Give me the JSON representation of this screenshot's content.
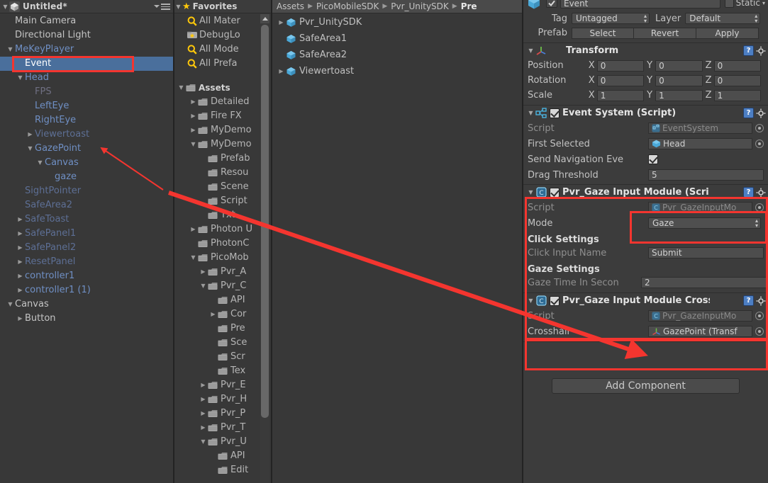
{
  "hierarchy": {
    "title": "Untitled*",
    "menu_icon": "hamburger-menu-icon",
    "items": [
      {
        "label": "Main Camera",
        "indent": 1,
        "tw": "",
        "style": "plain"
      },
      {
        "label": "Directional Light",
        "indent": 1,
        "tw": "",
        "style": "plain"
      },
      {
        "label": "MeKeyPlayer",
        "indent": 1,
        "tw": "down",
        "style": "go"
      },
      {
        "label": "Event",
        "indent": 2,
        "tw": "",
        "style": "go",
        "selected": true
      },
      {
        "label": "Head",
        "indent": 2,
        "tw": "down",
        "style": "go"
      },
      {
        "label": "FPS",
        "indent": 3,
        "tw": "",
        "style": "dim"
      },
      {
        "label": "LeftEye",
        "indent": 3,
        "tw": "",
        "style": "go"
      },
      {
        "label": "RightEye",
        "indent": 3,
        "tw": "",
        "style": "go"
      },
      {
        "label": "Viewertoast",
        "indent": 3,
        "tw": "right",
        "style": "dim-blue"
      },
      {
        "label": "GazePoint",
        "indent": 3,
        "tw": "down",
        "style": "go"
      },
      {
        "label": "Canvas",
        "indent": 4,
        "tw": "down",
        "style": "go"
      },
      {
        "label": "gaze",
        "indent": 5,
        "tw": "",
        "style": "go"
      },
      {
        "label": "SightPointer",
        "indent": 2,
        "tw": "",
        "style": "dim-blue"
      },
      {
        "label": "SafeArea2",
        "indent": 2,
        "tw": "",
        "style": "dim-blue"
      },
      {
        "label": "SafeToast",
        "indent": 2,
        "tw": "right",
        "style": "dim-blue"
      },
      {
        "label": "SafePanel1",
        "indent": 2,
        "tw": "right",
        "style": "dim-blue"
      },
      {
        "label": "SafePanel2",
        "indent": 2,
        "tw": "right",
        "style": "dim-blue"
      },
      {
        "label": "ResetPanel",
        "indent": 2,
        "tw": "right",
        "style": "dim-blue"
      },
      {
        "label": "controller1",
        "indent": 2,
        "tw": "right",
        "style": "go"
      },
      {
        "label": "controller1 (1)",
        "indent": 2,
        "tw": "right",
        "style": "go"
      },
      {
        "label": "Canvas",
        "indent": 1,
        "tw": "down",
        "style": "plain"
      },
      {
        "label": "Button",
        "indent": 2,
        "tw": "right",
        "style": "plain"
      }
    ]
  },
  "project_tree": {
    "favorites_label": "Favorites",
    "favorites": [
      {
        "label": "All Mater",
        "icon": "search-icon",
        "indent": 1
      },
      {
        "label": "DebugLo",
        "icon": "folder-favorite-icon",
        "indent": 1
      },
      {
        "label": "All Mode",
        "icon": "search-icon",
        "indent": 1
      },
      {
        "label": "All Prefa",
        "icon": "search-icon",
        "indent": 1
      }
    ],
    "assets_label": "Assets",
    "assets": [
      {
        "label": "Detailed",
        "indent": 1,
        "tw": "right"
      },
      {
        "label": "Fire FX",
        "indent": 1,
        "tw": "right"
      },
      {
        "label": "MyDemo",
        "indent": 1,
        "tw": "right"
      },
      {
        "label": "MyDemo",
        "indent": 1,
        "tw": "down"
      },
      {
        "label": "Prefab",
        "indent": 2,
        "tw": ""
      },
      {
        "label": "Resou",
        "indent": 2,
        "tw": ""
      },
      {
        "label": "Scene",
        "indent": 2,
        "tw": ""
      },
      {
        "label": "Script",
        "indent": 2,
        "tw": ""
      },
      {
        "label": "Txt",
        "indent": 2,
        "tw": ""
      },
      {
        "label": "Photon U",
        "indent": 1,
        "tw": "right"
      },
      {
        "label": "PhotonC",
        "indent": 1,
        "tw": ""
      },
      {
        "label": "PicoMob",
        "indent": 1,
        "tw": "down"
      },
      {
        "label": "Pvr_A",
        "indent": 2,
        "tw": "right"
      },
      {
        "label": "Pvr_C",
        "indent": 2,
        "tw": "down"
      },
      {
        "label": "API",
        "indent": 3,
        "tw": ""
      },
      {
        "label": "Cor",
        "indent": 3,
        "tw": "right"
      },
      {
        "label": "Pre",
        "indent": 3,
        "tw": ""
      },
      {
        "label": "Sce",
        "indent": 3,
        "tw": ""
      },
      {
        "label": "Scr",
        "indent": 3,
        "tw": ""
      },
      {
        "label": "Tex",
        "indent": 3,
        "tw": ""
      },
      {
        "label": "Pvr_E",
        "indent": 2,
        "tw": "right"
      },
      {
        "label": "Pvr_H",
        "indent": 2,
        "tw": "right"
      },
      {
        "label": "Pvr_P",
        "indent": 2,
        "tw": "right"
      },
      {
        "label": "Pvr_T",
        "indent": 2,
        "tw": "right"
      },
      {
        "label": "Pvr_U",
        "indent": 2,
        "tw": "down"
      },
      {
        "label": "API",
        "indent": 3,
        "tw": ""
      },
      {
        "label": "Edit",
        "indent": 3,
        "tw": ""
      }
    ]
  },
  "browser": {
    "breadcrumb": [
      {
        "label": "Assets",
        "current": false
      },
      {
        "label": "PicoMobileSDK",
        "current": false
      },
      {
        "label": "Pvr_UnitySDK",
        "current": false
      },
      {
        "label": "Pre",
        "current": true
      }
    ],
    "items": [
      {
        "label": "Pvr_UnitySDK",
        "tw": "right"
      },
      {
        "label": "SafeArea1",
        "tw": ""
      },
      {
        "label": "SafeArea2",
        "tw": ""
      },
      {
        "label": "Viewertoast",
        "tw": "right"
      }
    ]
  },
  "inspector": {
    "object_name": "Event",
    "static_label": "Static",
    "tag_label": "Tag",
    "tag_value": "Untagged",
    "layer_label": "Layer",
    "layer_value": "Default",
    "prefab_label": "Prefab",
    "prefab_buttons": [
      "Select",
      "Revert",
      "Apply"
    ],
    "transform": {
      "title": "Transform",
      "icon": "transform-axis-icon",
      "rows": [
        {
          "label": "Position",
          "x": "0",
          "y": "0",
          "z": "0"
        },
        {
          "label": "Rotation",
          "x": "0",
          "y": "0",
          "z": "0"
        },
        {
          "label": "Scale",
          "x": "1",
          "y": "1",
          "z": "1"
        }
      ],
      "axes": [
        "X",
        "Y",
        "Z"
      ]
    },
    "event_system": {
      "title": "Event System (Script)",
      "icon": "event-system-icon",
      "checked": true,
      "fields": [
        {
          "label": "Script",
          "value": "EventSystem",
          "type": "object-readonly",
          "icon": "script-icon"
        },
        {
          "label": "First Selected",
          "value": "Head",
          "type": "object",
          "icon": "gameobject-icon"
        },
        {
          "label": "Send Navigation Eve",
          "value": "",
          "type": "checkbox",
          "checked": true
        },
        {
          "label": "Drag Threshold",
          "value": "5",
          "type": "text"
        }
      ]
    },
    "gaze_module": {
      "title": "Pvr_Gaze Input Module (Scri",
      "icon": "csharp-script-icon",
      "checked": true,
      "script_label": "Script",
      "script_value": "Pvr_GazeInputMo",
      "mode_label": "Mode",
      "mode_value": "Gaze",
      "click_settings_header": "Click Settings",
      "click_input_label": "Click Input Name",
      "click_input_value": "Submit",
      "gaze_settings_header": "Gaze Settings",
      "gaze_time_label": "Gaze Time In Secon",
      "gaze_time_value": "2"
    },
    "gaze_crosshair_module": {
      "title": "Pvr_Gaze Input Module Cross",
      "icon": "csharp-script-icon",
      "checked": true,
      "script_label": "Script",
      "script_value": "Pvr_GazeInputMo",
      "crosshair_label": "Crosshair",
      "crosshair_value": "GazePoint (Transf"
    },
    "add_component_label": "Add Component"
  },
  "annotations": {
    "highlight_color": "#f4352f",
    "boxes": [
      {
        "name": "event-hierarchy-highlight"
      },
      {
        "name": "gaze-mode-highlight"
      },
      {
        "name": "crosshair-module-highlight"
      }
    ],
    "arrows": [
      {
        "name": "gazepoint-to-crosshair-arrow"
      },
      {
        "name": "short-gazepoint-arrow"
      }
    ]
  }
}
